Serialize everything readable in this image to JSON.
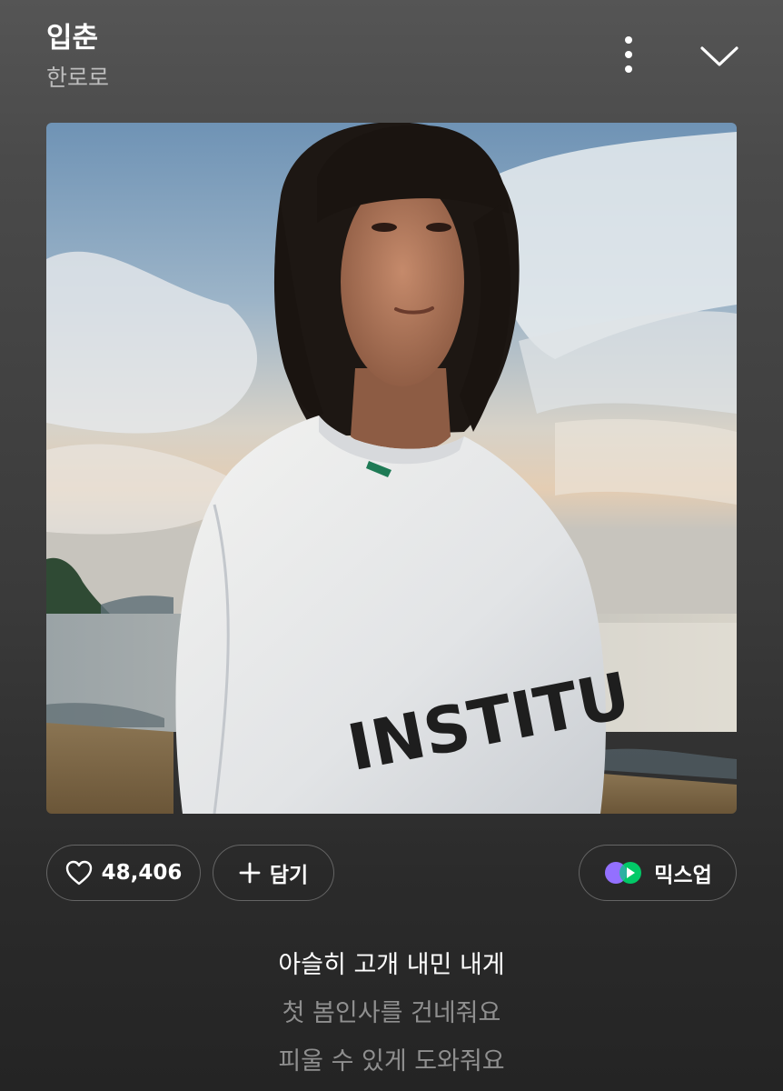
{
  "header": {
    "title": "입춘",
    "artist": "한로로"
  },
  "album": {
    "shirt_print": "INSTITU"
  },
  "actions": {
    "like_count": "48,406",
    "add_label": "담기",
    "mixup_label": "믹스업"
  },
  "lyrics": [
    {
      "text": "아슬히 고개 내민 내게",
      "current": true
    },
    {
      "text": "첫 봄인사를 건네줘요",
      "current": false
    },
    {
      "text": "피울 수 있게 도와줘요",
      "current": false
    }
  ],
  "icons": {
    "more": "more-vertical-icon",
    "collapse": "chevron-down-icon",
    "like": "heart-icon",
    "add": "plus-icon",
    "mixup": "mixup-logo-icon"
  },
  "colors": {
    "background_top": "#555555",
    "background_bottom": "#242424",
    "text_primary": "#ffffff",
    "text_secondary": "#8f8f8f",
    "mixup_purple": "#a66bff",
    "mixup_green": "#00d26a"
  }
}
